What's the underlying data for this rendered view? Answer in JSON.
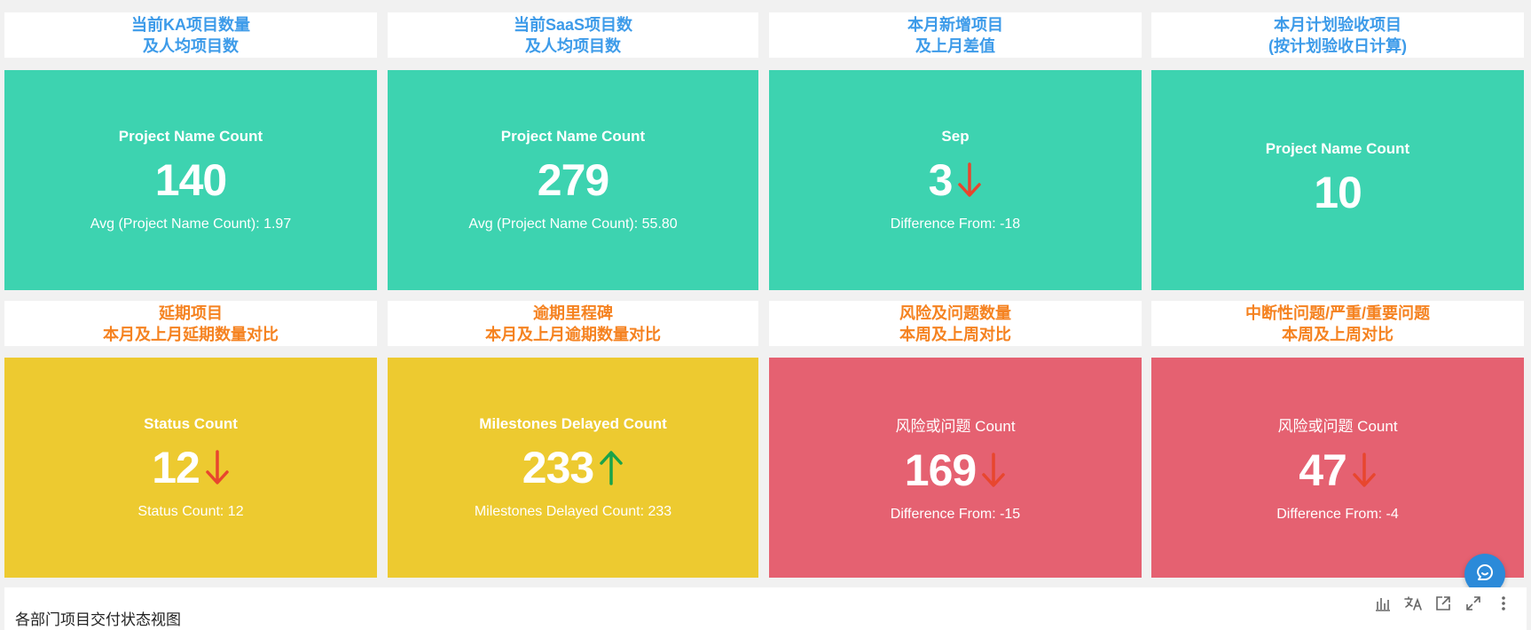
{
  "row1": {
    "headers": [
      {
        "line1": "当前KA项目数量",
        "line2": "及人均项目数"
      },
      {
        "line1": "当前SaaS项目数",
        "line2": "及人均项目数"
      },
      {
        "line1": "本月新增项目",
        "line2": "及上月差值"
      },
      {
        "line1": "本月计划验收项目",
        "line2": "(按计划验收日计算)"
      }
    ],
    "cards": [
      {
        "label": "Project Name Count",
        "value": "140",
        "sub": "Avg (Project Name Count): 1.97"
      },
      {
        "label": "Project Name Count",
        "value": "279",
        "sub": "Avg (Project Name Count): 55.80"
      },
      {
        "label": "Sep",
        "value": "3",
        "sub": "Difference From: -18",
        "arrow": "down"
      },
      {
        "label": "Project Name Count",
        "value": "10"
      }
    ]
  },
  "row2": {
    "headers": [
      {
        "line1": "延期项目",
        "line2": "本月及上月延期数量对比"
      },
      {
        "line1": "逾期里程碑",
        "line2": "本月及上月逾期数量对比"
      },
      {
        "line1": "风险及问题数量",
        "line2": "本周及上周对比"
      },
      {
        "line1": "中断性问题/严重/重要问题",
        "line2": "本周及上周对比"
      }
    ],
    "cards": [
      {
        "label": "Status Count",
        "value": "12",
        "sub": "Status Count: 12",
        "arrow": "down"
      },
      {
        "label": "Milestones Delayed Count",
        "value": "233",
        "sub": "Milestones Delayed Count: 233",
        "arrow": "up"
      },
      {
        "label": "风险或问题 Count",
        "value": "169",
        "sub": "Difference From: -15",
        "arrow": "down"
      },
      {
        "label": "风险或问题 Count",
        "value": "47",
        "sub": "Difference From: -4",
        "arrow": "down"
      }
    ]
  },
  "bottom": {
    "title": "各部门项目交付状态视图",
    "toolbar_icons": [
      "bar-chart-icon",
      "language-icon",
      "open-external-icon",
      "expand-icon",
      "more-vertical-icon"
    ]
  },
  "colors": {
    "header_blue": "#3d9be9",
    "header_orange": "#f58220",
    "green": "#3dd3b0",
    "yellow": "#edca30",
    "red": "#e56171",
    "arrow_down": "#e8462e",
    "arrow_up": "#1aa34a",
    "chat": "#2b8ad9"
  }
}
